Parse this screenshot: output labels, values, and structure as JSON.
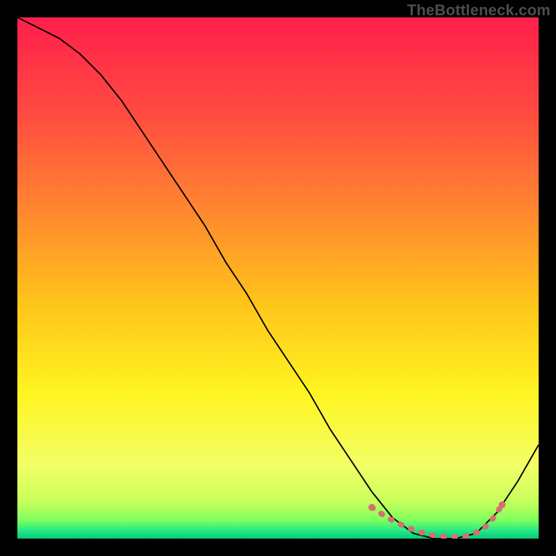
{
  "watermark": "TheBottleneck.com",
  "gradient": {
    "stops": [
      {
        "offset": 0.0,
        "color": "#ff1f4b"
      },
      {
        "offset": 0.18,
        "color": "#ff4a41"
      },
      {
        "offset": 0.38,
        "color": "#ff8a2e"
      },
      {
        "offset": 0.55,
        "color": "#ffc51a"
      },
      {
        "offset": 0.72,
        "color": "#fff421"
      },
      {
        "offset": 0.86,
        "color": "#f3ff66"
      },
      {
        "offset": 0.93,
        "color": "#c6ff5a"
      },
      {
        "offset": 0.965,
        "color": "#7cff5e"
      },
      {
        "offset": 0.985,
        "color": "#22e986"
      },
      {
        "offset": 1.0,
        "color": "#08c97b"
      }
    ]
  },
  "chart_data": {
    "type": "line",
    "title": "",
    "xlabel": "",
    "ylabel": "",
    "xlim": [
      0,
      100
    ],
    "ylim": [
      0,
      100
    ],
    "series": [
      {
        "name": "bottleneck-curve",
        "x": [
          0,
          4,
          8,
          12,
          16,
          20,
          24,
          28,
          32,
          36,
          40,
          44,
          48,
          52,
          56,
          60,
          64,
          68,
          72,
          76,
          80,
          84,
          88,
          92,
          96,
          100
        ],
        "y": [
          100,
          98,
          96,
          93,
          89,
          84,
          78,
          72,
          66,
          60,
          53,
          47,
          40,
          34,
          28,
          21,
          15,
          9,
          4,
          1,
          0,
          0,
          1,
          5,
          11,
          18
        ]
      }
    ],
    "highlight": {
      "name": "optimum-band",
      "color": "#d66f6f",
      "x": [
        68,
        71,
        74,
        77,
        80,
        83,
        86,
        89,
        91,
        93
      ],
      "y": [
        6,
        4,
        2.5,
        1.3,
        0.6,
        0.3,
        0.5,
        1.5,
        3.5,
        6.5
      ]
    }
  }
}
